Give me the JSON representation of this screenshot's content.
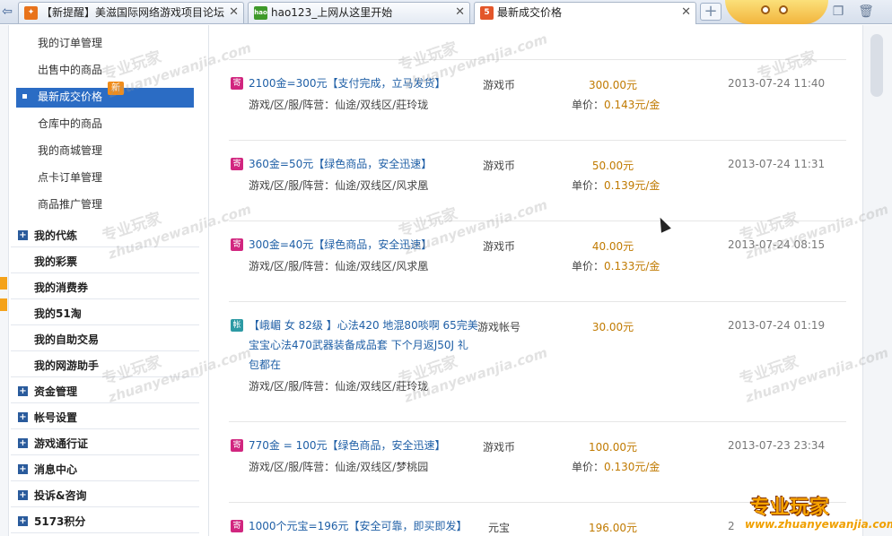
{
  "tabs": [
    {
      "label": "【新提醒】美滋国际网络游戏项目论坛",
      "active": false
    },
    {
      "label": "hao123_上网从这里开始",
      "active": false,
      "favicon": "hao"
    },
    {
      "label": "最新成交价格",
      "active": true,
      "favicon": "5"
    }
  ],
  "sidebar": {
    "sub_items": [
      "我的订单管理",
      "出售中的商品",
      "最新成交价格",
      "仓库中的商品",
      "我的商城管理",
      "点卡订单管理",
      "商品推广管理"
    ],
    "active_badge": "新",
    "groups": [
      {
        "label": "我的代练",
        "expandable": true
      },
      {
        "label": "我的彩票",
        "expandable": false
      },
      {
        "label": "我的消费券",
        "expandable": false
      },
      {
        "label": "我的51淘",
        "expandable": false
      },
      {
        "label": "我的自助交易",
        "expandable": false
      },
      {
        "label": "我的网游助手",
        "expandable": false
      },
      {
        "label": "资金管理",
        "expandable": true
      },
      {
        "label": "帐号设置",
        "expandable": true
      },
      {
        "label": "游戏通行证",
        "expandable": true
      },
      {
        "label": "消息中心",
        "expandable": true
      },
      {
        "label": "投诉&咨询",
        "expandable": true
      },
      {
        "label": "5173积分",
        "expandable": true
      }
    ]
  },
  "records": [
    {
      "tag": "寄",
      "title": "2100金=300元【支付完成，立马发货】",
      "title2": "",
      "title3": "",
      "server": "游戏/区/服/阵营：仙途/双线区/莊玲珑",
      "category": "游戏币",
      "price": "300.00元",
      "unit_label": "单价：",
      "unit_value": "0.143元/金",
      "date": "2013-07-24 11:40"
    },
    {
      "tag": "寄",
      "title": "360金=50元【绿色商品，安全迅速】",
      "title2": "",
      "title3": "",
      "server": "游戏/区/服/阵营：仙途/双线区/风求凰",
      "category": "游戏币",
      "price": "50.00元",
      "unit_label": "单价：",
      "unit_value": "0.139元/金",
      "date": "2013-07-24 11:31"
    },
    {
      "tag": "寄",
      "title": "300金=40元【绿色商品，安全迅速】",
      "title2": "",
      "title3": "",
      "server": "游戏/区/服/阵营：仙途/双线区/风求凰",
      "category": "游戏币",
      "price": "40.00元",
      "unit_label": "单价：",
      "unit_value": "0.133元/金",
      "date": "2013-07-24 08:15"
    },
    {
      "tag": "帐",
      "title": "【峨嵋 女 82级 】心法420 地混80啖啊 65完美",
      "title2": "宝宝心法470武器装备成品套 下个月返J50J 礼",
      "title3": "包都在",
      "server": "游戏/区/服/阵营：仙途/双线区/莊玲珑",
      "category": "游戏帐号",
      "price": "30.00元",
      "unit_label": "",
      "unit_value": "",
      "date": "2013-07-24 01:19"
    },
    {
      "tag": "寄",
      "title": "770金 = 100元【绿色商品，安全迅速】",
      "title2": "",
      "title3": "",
      "server": "游戏/区/服/阵营：仙途/双线区/梦桃园",
      "category": "游戏币",
      "price": "100.00元",
      "unit_label": "单价：",
      "unit_value": "0.130元/金",
      "date": "2013-07-23 23:34"
    },
    {
      "tag": "寄",
      "title": "1000个元宝=196元【安全可靠，即买即发】",
      "title2": "",
      "title3": "",
      "server": "",
      "category": "元宝",
      "price": "196.00元",
      "unit_label": "",
      "unit_value": "",
      "date": "2"
    }
  ],
  "watermark": {
    "cn": "专业玩家",
    "en": "zhuanyewanjia.com"
  },
  "brand_logo": {
    "cn": "专业玩家",
    "en": "www.zhuanyewanjia.com"
  },
  "colors": {
    "accent": "#2b6cc4",
    "link": "#1f5fa6",
    "price": "#c07a00",
    "tag_ji": "#d1267f",
    "tag_zhang": "#2d9aa4"
  },
  "icons": [
    "back-arrow-icon",
    "new-tab-icon",
    "window-icon",
    "trash-icon",
    "plus-icon"
  ]
}
